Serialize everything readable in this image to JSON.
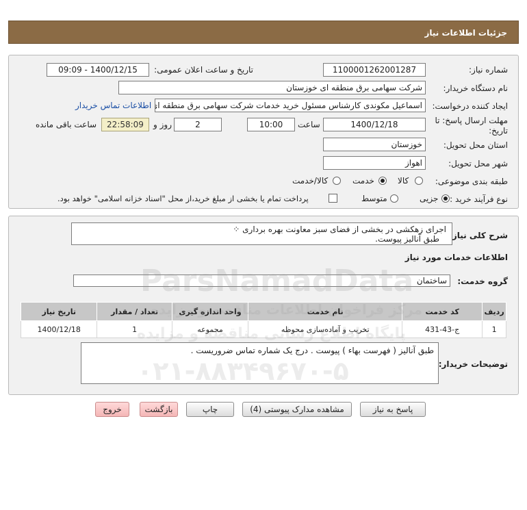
{
  "header": {
    "title": "جزئیات اطلاعات نیاز"
  },
  "form": {
    "need_number_label": "شماره نیاز:",
    "need_number": "1100001262001287",
    "announce_label": "تاریخ و ساعت اعلان عمومی:",
    "announce_value": "1400/12/15 - 09:09",
    "buyer_label": "نام دستگاه خریدار:",
    "buyer_value": "شرکت سهامی برق منطقه ای خوزستان",
    "creator_label": "ایجاد کننده درخواست:",
    "creator_value": "اسماعیل مکوندی کارشناس مسئول خرید خدمات شرکت سهامی برق منطقه ای",
    "contact_link": "اطلاعات تماس خریدار",
    "deadline_label_1": "مهلت ارسال پاسخ: تا",
    "deadline_label_2": "تاریخ:",
    "deadline_date": "1400/12/18",
    "time_label": "ساعت",
    "deadline_time": "10:00",
    "days_value": "2",
    "days_label": "روز و",
    "remaining_value": "22:58:09",
    "remaining_label": "ساعت باقی مانده",
    "province_label": "استان محل تحویل:",
    "province_value": "خوزستان",
    "city_label": "شهر محل تحویل:",
    "city_value": "اهواز",
    "category_label": "طبقه بندی موضوعی:",
    "category_options": [
      "کالا",
      "خدمت",
      "کالا/خدمت"
    ],
    "category_selected": "خدمت",
    "process_label": "نوع فرآیند خرید :",
    "process_options": [
      "جزیی",
      "متوسط"
    ],
    "process_selected": "جزیی",
    "payment_note": "پرداخت تمام یا بخشی از مبلغ خرید،از محل \"اسناد خزانه اسلامی\" خواهد بود."
  },
  "summary": {
    "label": "شرح کلی نیاز:",
    "line1": "اجرای زهکشی در بخشی از فضای سبز معاونت بهره برداری",
    "line2": "طبق آنالیز پیوست."
  },
  "services": {
    "section_title": "اطلاعات خدمات مورد نیاز",
    "group_label": "گروه خدمت:",
    "group_value": "ساختمان",
    "columns": [
      "ردیف",
      "کد خدمت",
      "نام خدمت",
      "واحد اندازه گیری",
      "تعداد / مقدار",
      "تاریخ نیاز"
    ],
    "rows": [
      [
        "1",
        "ج-43-431",
        "تخریب و آماده‌سازی محوطه",
        "مجموعه",
        "1",
        "1400/12/18"
      ]
    ]
  },
  "buyer_notes": {
    "label": "توضیحات خریدار:",
    "text": "طبق آنالیز ( فهرست بهاء ) پیوست . درج یک شماره تماس ضروریست ."
  },
  "buttons": {
    "reply": "پاسخ به نیاز",
    "docs": "مشاهده مدارک پیوستی (4)",
    "print": "چاپ",
    "back": "بازگشت",
    "exit": "خروج"
  },
  "watermark": {
    "line1": "ParsNamadData",
    "line2": "مرکز فراخوان اطلاعات مناقصه و مزایده",
    "line3": "پایگاه اطلاع رسانی مناقصه و مزایده",
    "line4": "۰۲۱-۸۸۳۴۹۶۷۰-۵"
  },
  "colors": {
    "header_bg": "#8b6b45",
    "panel_bg": "#f1f1f1",
    "link": "#1b4fa5",
    "remaining_bg": "#f4efc8",
    "exit_bg": "#f4b6b6"
  }
}
